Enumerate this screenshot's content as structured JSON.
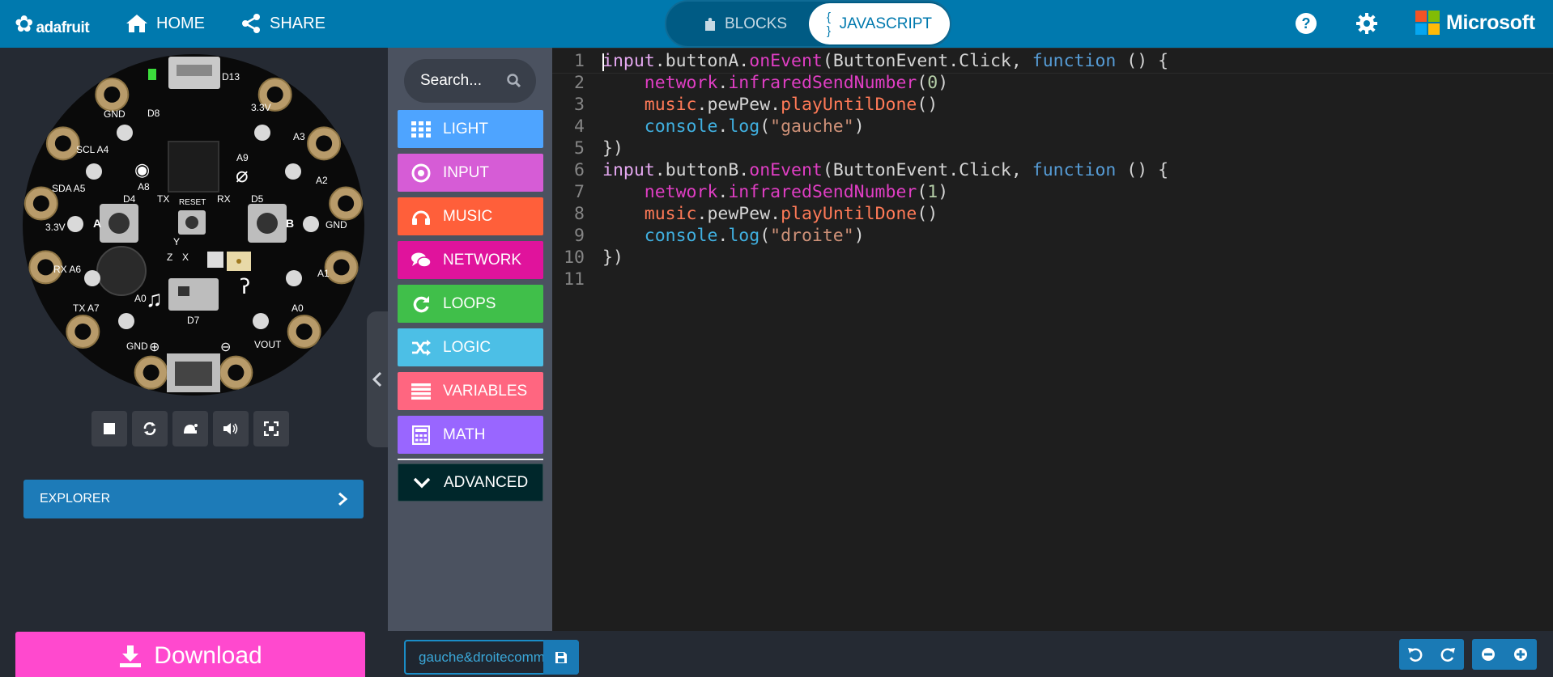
{
  "brand": {
    "logo_text": "adafruit",
    "microsoft_text": "Microsoft"
  },
  "nav": {
    "home_label": "HOME",
    "share_label": "SHARE"
  },
  "editor_toggle": {
    "blocks_label": "BLOCKS",
    "js_label": "JAVASCRIPT",
    "js_icon": "{ }"
  },
  "colors": {
    "topbar": "#0079ae",
    "download": "#ff49ce",
    "explorer": "#1d7bb8",
    "ms_red": "#f35325",
    "ms_green": "#81bc06",
    "ms_blue": "#05a6f0",
    "ms_yellow": "#ffba08"
  },
  "simulator": {
    "board_labels": {
      "d13": "D13",
      "d8": "D8",
      "d4": "D4",
      "d5": "D5",
      "a8": "A8",
      "a9": "A9",
      "tx": "TX",
      "rx": "RX",
      "reset": "RESET",
      "a0": "A0",
      "d7": "D7",
      "gnd_top": "GND",
      "gnd_bottom": "GND",
      "gnd_right": "GND",
      "v33_left": "3.3V",
      "v33_top": "3.3V",
      "scl_a4": "SCL A4",
      "sda_a5": "SDA A5",
      "rx_a6": "RX A6",
      "tx_a7": "TX A7",
      "a1": "A1",
      "a2": "A2",
      "a3": "A3",
      "vout": "VOUT",
      "btn_a": "A",
      "btn_b": "B",
      "d13_led": "D13",
      "a0_right": "A0",
      "axis_y": "Y",
      "axis_z": "Z",
      "axis_x": "X",
      "plus": "⊕",
      "minus": "⊖"
    },
    "controls": [
      "stop-icon",
      "restart-icon",
      "slow-mo-icon",
      "mute-icon",
      "fullscreen-icon"
    ],
    "explorer_label": "EXPLORER",
    "download_label": "Download"
  },
  "toolbox": {
    "search_placeholder": "Search...",
    "categories": [
      {
        "label": "LIGHT",
        "color": "#4ea4ff",
        "icon": "grid-icon"
      },
      {
        "label": "INPUT",
        "color": "#d65cd6",
        "icon": "target-icon"
      },
      {
        "label": "MUSIC",
        "color": "#ff5f3a",
        "icon": "headphones-icon"
      },
      {
        "label": "NETWORK",
        "color": "#e0139c",
        "icon": "chat-icon"
      },
      {
        "label": "LOOPS",
        "color": "#40bf4a",
        "icon": "refresh-icon"
      },
      {
        "label": "LOGIC",
        "color": "#4cbfe6",
        "icon": "shuffle-icon"
      },
      {
        "label": "VARIABLES",
        "color": "#ff6680",
        "icon": "list-icon"
      },
      {
        "label": "MATH",
        "color": "#9966ff",
        "icon": "calculator-icon"
      }
    ],
    "advanced_label": "ADVANCED",
    "advanced_color": "#00272b"
  },
  "code": {
    "line_numbers": [
      "1",
      "2",
      "3",
      "4",
      "5",
      "6",
      "7",
      "8",
      "9",
      "10",
      "11"
    ],
    "tokens": {
      "input": "input",
      "buttonA": "buttonA",
      "buttonB": "buttonB",
      "onEvent": "onEvent",
      "ButtonEvent": "ButtonEvent",
      "Click": "Click",
      "function": "function",
      "network": "network",
      "infraredSendNumber": "infraredSendNumber",
      "music": "music",
      "pewPew": "pewPew",
      "playUntilDone": "playUntilDone",
      "console": "console",
      "log": "log",
      "num0": "0",
      "num1": "1",
      "str_gauche": "\"gauche\"",
      "str_droite": "\"droite\""
    }
  },
  "bottom": {
    "project_name": "gauche&droitecommande"
  }
}
